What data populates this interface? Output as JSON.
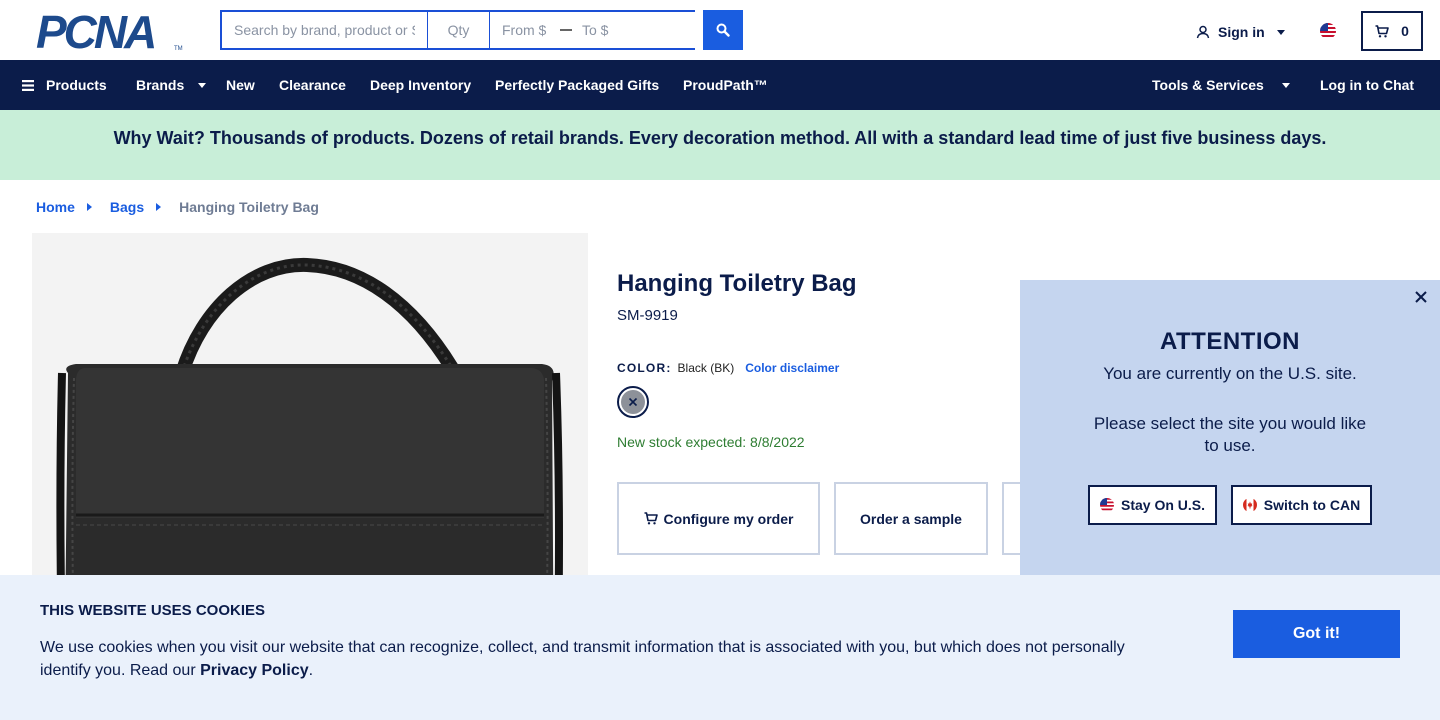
{
  "header": {
    "logo_text": "PCNA",
    "logo_mark": "TM",
    "search": {
      "main_placeholder": "Search by brand, product or SKU",
      "qty_placeholder": "Qty",
      "from_placeholder": "From $",
      "to_placeholder": "To $"
    },
    "sign_in_label": "Sign in",
    "cart_count": "0"
  },
  "nav": {
    "products": "Products",
    "brands": "Brands",
    "new": "New",
    "clearance": "Clearance",
    "deep_inventory": "Deep Inventory",
    "gifts": "Perfectly Packaged Gifts",
    "proudpath": "ProudPath™",
    "tools": "Tools & Services",
    "chat": "Log in to Chat"
  },
  "promo": {
    "text": "Why Wait? Thousands of products. Dozens of retail brands. Every decoration method. All with a standard lead time of just five business days."
  },
  "breadcrumb": {
    "home": "Home",
    "category": "Bags",
    "current": "Hanging Toiletry Bag"
  },
  "product": {
    "title": "Hanging Toiletry Bag",
    "sku": "SM-9919",
    "color_label": "COLOR:",
    "color_value": "Black (BK)",
    "color_disclaimer": "Color disclaimer",
    "stock_note": "New stock expected: 8/8/2022",
    "actions": {
      "configure": "Configure my order",
      "sample": "Order a sample"
    }
  },
  "attention": {
    "heading": "ATTENTION",
    "line1": "You are currently on the U.S. site.",
    "line2": "Please select the site you would like to use.",
    "stay_label": "Stay On U.S.",
    "switch_label": "Switch to CAN"
  },
  "cookie": {
    "title": "THIS WEBSITE USES COOKIES",
    "body": "We use cookies when you visit our website that can recognize, collect, and transmit information that is associated with you, but which does not personally identify you. Read our ",
    "link": "Privacy Policy",
    "end": ".",
    "button": "Got it!"
  },
  "colors": {
    "navy": "#0b1c4a",
    "accent_blue": "#1a5de0",
    "promo_green": "#c8eed8",
    "popup_bg": "#c5d5ef",
    "cookie_bg": "#eaf1fb",
    "stock_green": "#2e7d32"
  },
  "icons": [
    "search-icon",
    "user-icon",
    "us-flag-icon",
    "cart-icon",
    "hamburger-icon",
    "close-icon",
    "canada-flag-icon"
  ]
}
